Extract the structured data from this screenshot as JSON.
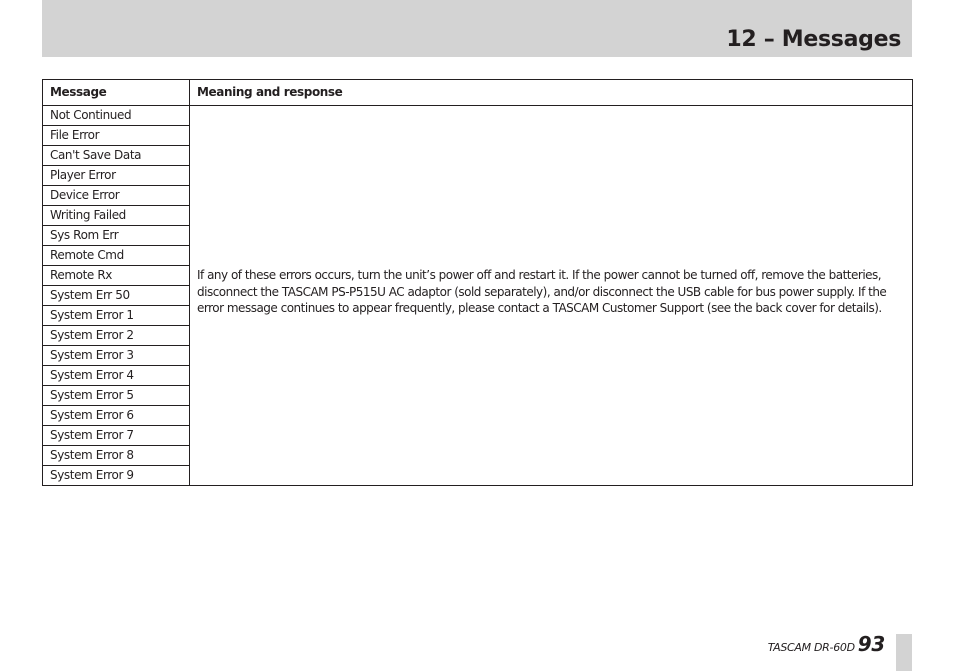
{
  "header": {
    "chapter_title": "12 – Messages"
  },
  "table": {
    "columns": [
      "Message",
      "Meaning and response"
    ],
    "messages": [
      "Not Continued",
      "File Error",
      "Can't Save Data",
      "Player Error",
      "Device Error",
      "Writing Failed",
      "Sys Rom Err",
      "Remote Cmd",
      "Remote Rx",
      "System Err 50",
      "System Error 1",
      "System Error 2",
      "System Error 3",
      "System Error 4",
      "System Error 5",
      "System Error 6",
      "System Error 7",
      "System Error 8",
      "System Error 9"
    ],
    "meaning": "If any of these errors occurs, turn the unit’s power off and restart it. If the power cannot be turned off, remove the batteries, disconnect the TASCAM PS-P515U AC adaptor (sold separately), and/or disconnect the USB cable for bus power supply. If the error message continues to appear frequently, please contact a TASCAM Customer Support (see the back cover for details)."
  },
  "footer": {
    "brand": "TASCAM  DR-60D",
    "page_number": "93"
  }
}
